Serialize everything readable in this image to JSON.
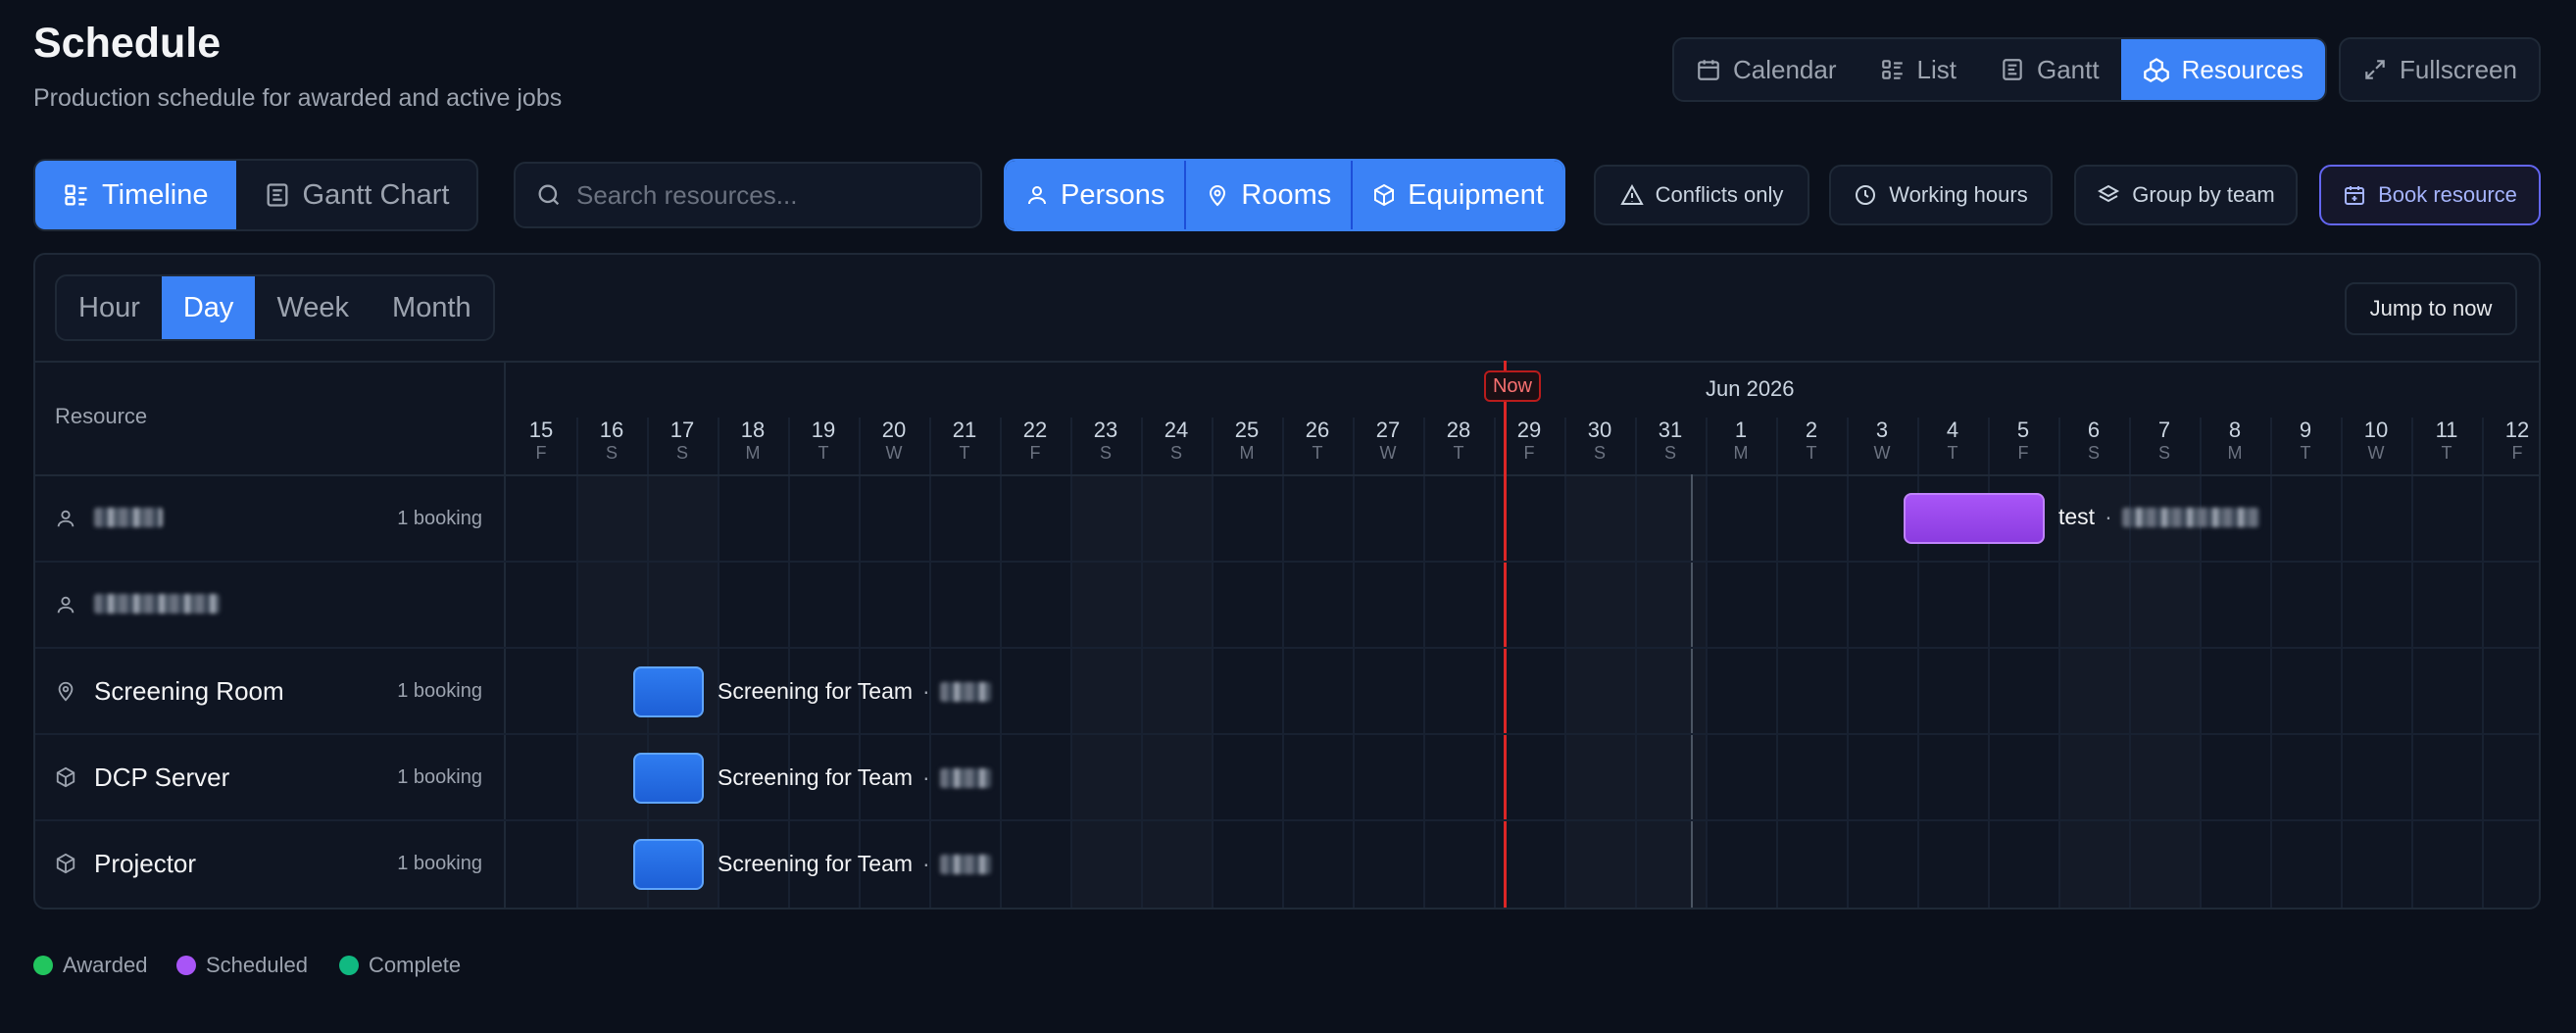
{
  "header": {
    "title": "Schedule",
    "subtitle": "Production schedule for awarded and active jobs"
  },
  "view_switcher": {
    "items": [
      {
        "label": "Calendar",
        "icon": "calendar-icon",
        "active": false
      },
      {
        "label": "List",
        "icon": "list-icon",
        "active": false
      },
      {
        "label": "Gantt",
        "icon": "gantt-icon",
        "active": false
      },
      {
        "label": "Resources",
        "icon": "resources-icon",
        "active": true
      }
    ],
    "fullscreen_label": "Fullscreen"
  },
  "toolbar": {
    "layout_tabs": [
      {
        "label": "Timeline",
        "icon": "timeline-icon",
        "active": true
      },
      {
        "label": "Gantt Chart",
        "icon": "gantt-chart-icon",
        "active": false
      }
    ],
    "search_placeholder": "Search resources...",
    "resource_types": [
      {
        "label": "Persons",
        "icon": "person-icon"
      },
      {
        "label": "Rooms",
        "icon": "location-pin-icon"
      },
      {
        "label": "Equipment",
        "icon": "cube-icon"
      }
    ],
    "filters": {
      "conflicts_only": "Conflicts only",
      "working_hours": "Working hours",
      "group_by_team": "Group by team"
    },
    "book_resource": "Book resource"
  },
  "timeline": {
    "scale_tabs": [
      {
        "label": "Hour",
        "active": false
      },
      {
        "label": "Day",
        "active": true
      },
      {
        "label": "Week",
        "active": false
      },
      {
        "label": "Month",
        "active": false
      }
    ],
    "jump_to_now": "Jump to now",
    "resource_column_header": "Resource",
    "now_label": "Now",
    "month_label": "Jun 2026",
    "days": [
      {
        "n": "15",
        "w": "F"
      },
      {
        "n": "16",
        "w": "S"
      },
      {
        "n": "17",
        "w": "S"
      },
      {
        "n": "18",
        "w": "M"
      },
      {
        "n": "19",
        "w": "T"
      },
      {
        "n": "20",
        "w": "W"
      },
      {
        "n": "21",
        "w": "T"
      },
      {
        "n": "22",
        "w": "F"
      },
      {
        "n": "23",
        "w": "S"
      },
      {
        "n": "24",
        "w": "S"
      },
      {
        "n": "25",
        "w": "M"
      },
      {
        "n": "26",
        "w": "T"
      },
      {
        "n": "27",
        "w": "W"
      },
      {
        "n": "28",
        "w": "T"
      },
      {
        "n": "29",
        "w": "F"
      },
      {
        "n": "30",
        "w": "S"
      },
      {
        "n": "31",
        "w": "S"
      },
      {
        "n": "1",
        "w": "M"
      },
      {
        "n": "2",
        "w": "T"
      },
      {
        "n": "3",
        "w": "W"
      },
      {
        "n": "4",
        "w": "T"
      },
      {
        "n": "5",
        "w": "F"
      },
      {
        "n": "6",
        "w": "S"
      },
      {
        "n": "7",
        "w": "S"
      },
      {
        "n": "8",
        "w": "M"
      },
      {
        "n": "9",
        "w": "T"
      },
      {
        "n": "10",
        "w": "W"
      },
      {
        "n": "11",
        "w": "T"
      },
      {
        "n": "12",
        "w": "F"
      }
    ],
    "resources": [
      {
        "name": "",
        "icon": "person-icon",
        "count": "1 booking",
        "redacted": true
      },
      {
        "name": "",
        "icon": "person-icon",
        "count": "",
        "redacted": true
      },
      {
        "name": "Screening Room",
        "icon": "location-pin-icon",
        "count": "1 booking"
      },
      {
        "name": "DCP Server",
        "icon": "cube-icon",
        "count": "1 booking"
      },
      {
        "name": "Projector",
        "icon": "cube-icon",
        "count": "1 booking"
      }
    ],
    "bookings": [
      {
        "label": "test",
        "color": "#a855f7",
        "separator": "·"
      },
      {
        "label": "Screening for Team",
        "color": "#3b82f6",
        "separator": "·"
      },
      {
        "label": "Screening for Team",
        "color": "#3b82f6",
        "separator": "·"
      },
      {
        "label": "Screening for Team",
        "color": "#3b82f6",
        "separator": "·"
      }
    ]
  },
  "legend": [
    {
      "label": "Awarded",
      "color": "#22c55e"
    },
    {
      "label": "Scheduled",
      "color": "#a855f7"
    },
    {
      "label": "Complete",
      "color": "#10b981"
    }
  ],
  "colors": {
    "accent": "#3b82f6",
    "now_line": "#dc2626",
    "background": "#0b101b"
  }
}
